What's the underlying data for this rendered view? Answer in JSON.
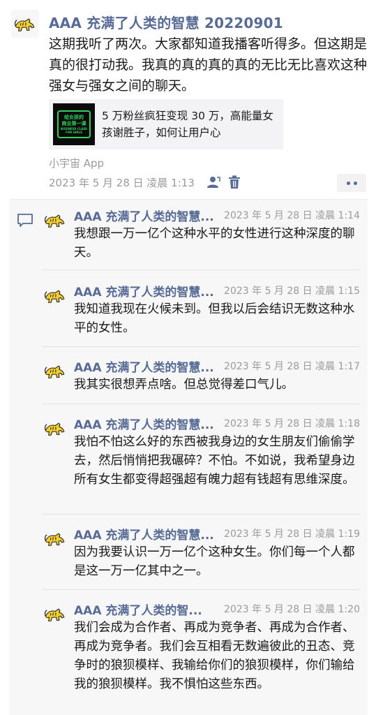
{
  "post": {
    "author": "AAA 充满了人类的智慧 20220901",
    "text": "这期我听了两次。大家都知道我播客听得多。但这期是真的很打动我。我真的真的真的真的无比无比喜欢这种强女与强女之间的聊天。",
    "link": {
      "title": "5 万粉丝疯狂变现 30 万，高能量女孩谢胜子，如何让用户心",
      "thumb_line1": "给女孩的",
      "thumb_line2": "商业第一课",
      "thumb_sub": "BUSINESS CLASS FOR GIRLS"
    },
    "source": "小宇宙 App",
    "time": "2023 年 5 月 28 日 凌晨 1:13",
    "avatar_icon": "tiger-avatar-icon"
  },
  "comments": [
    {
      "author": "AAA 充满了人类的智慧...",
      "time": "2023 年 5 月 28 日 凌晨 1:14",
      "text": "我想跟一万一亿个这种水平的女性进行这种深度的聊天。"
    },
    {
      "author": "AAA 充满了人类的智慧...",
      "time": "2023 年 5 月 28 日 凌晨 1:15",
      "text": "我知道我现在火候未到。但我以后会结识无数这种水平的女性。"
    },
    {
      "author": "AAA 充满了人类的智慧...",
      "time": "2023 年 5 月 28 日 凌晨 1:17",
      "text": "我其实很想弄点啥。但总觉得差口气儿。"
    },
    {
      "author": "AAA 充满了人类的智慧...",
      "time": "2023 年 5 月 28 日 凌晨 1:18",
      "text": "我怕不怕这么好的东西被我身边的女生朋友们偷偷学去，然后悄悄把我碾碎？不怕。不如说，我希望身边所有女生都变得超强超有魄力超有钱超有思维深度。"
    },
    {
      "author": "AAA 充满了人类的智慧...",
      "time": "2023 年 5 月 28 日 凌晨 1:19",
      "text": "因为我要认识一万一亿个这种女生。你们每一个人都是这一万一亿其中之一。"
    },
    {
      "author": "AAA 充满了人类的智...",
      "time": "2023 年 5 月 28 日 凌晨 1:20",
      "text": "我们会成为合作者、再成为竞争者、再成为合作者、再成为竞争者。我们会互相看无数遍彼此的丑态、竞争时的狼狈模样、我输给你们的狼狈模样，你们输给我的狼狈模样。我不惧怕这些东西。"
    }
  ],
  "colors": {
    "name_link": "#576b95",
    "secondary_text": "#9a9a9a",
    "comment_bg": "#f7f7f7",
    "avatar_yellow": "#f4cf2f"
  }
}
